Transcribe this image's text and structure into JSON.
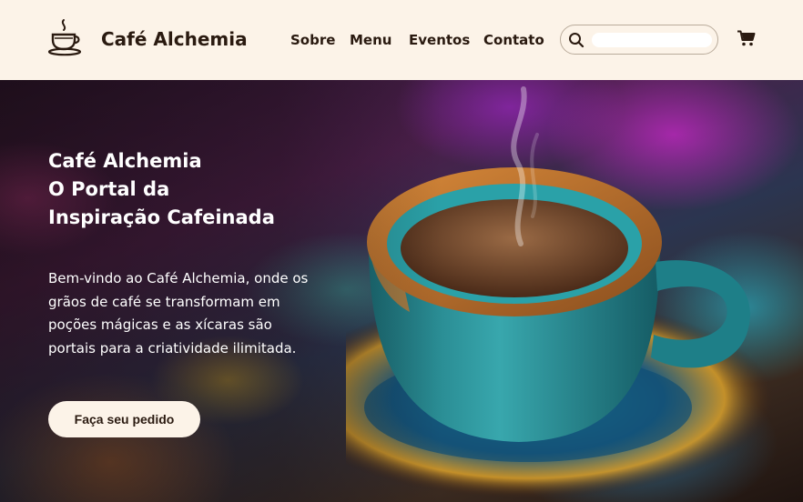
{
  "header": {
    "brand": "Café Alchemia",
    "nav": [
      "Sobre",
      "Menu",
      "Eventos",
      "Contato"
    ],
    "search": {
      "placeholder": ""
    }
  },
  "hero": {
    "title_lines": [
      "Café Alchemia",
      "O Portal da",
      "Inspiração Cafeinada"
    ],
    "text": "Bem-vindo ao Café Alchemia, onde os grãos de café se transformam em poções mágicas e as xícaras são portais para a criatividade ilimitada.",
    "cta": "Faça seu pedido"
  },
  "icons": {
    "logo": "coffee-cup-icon",
    "search": "search-icon",
    "cart": "cart-icon"
  },
  "colors": {
    "header_bg": "#fcf3e8",
    "text_dark": "#2a1a10",
    "hero_text": "#ffffff",
    "button_bg": "#fcf3e8"
  }
}
